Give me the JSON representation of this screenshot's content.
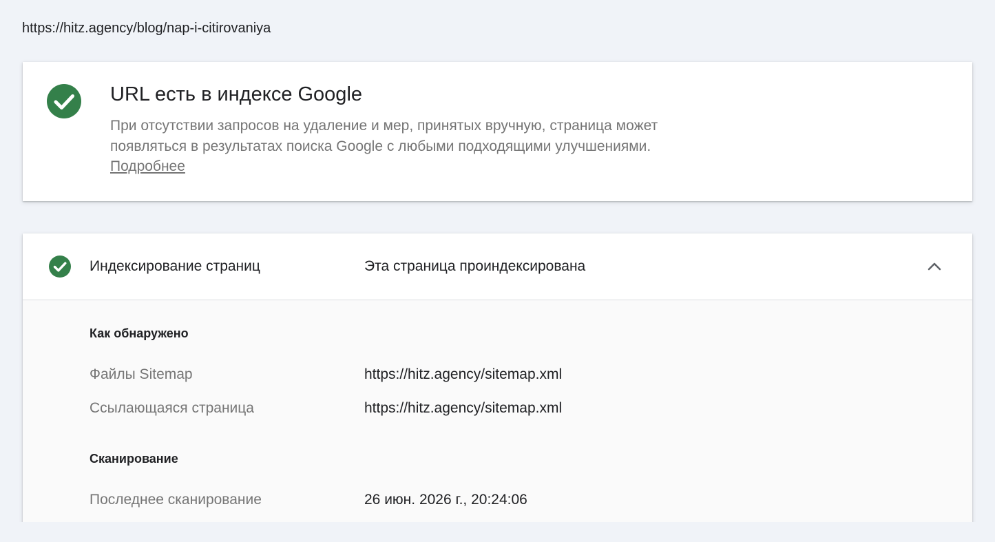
{
  "page_url": "https://hitz.agency/blog/nap-i-citirovaniya",
  "summary": {
    "title": "URL есть в индексе Google",
    "description_line1": "При отсутствии запросов на удаление и мер, принятых вручную, страница может",
    "description_line2": "появляться в результатах поиска Google с любыми подходящими улучшениями.",
    "learn_more": "Подробнее"
  },
  "indexing": {
    "title": "Индексирование страниц",
    "status": "Эта страница проиндексирована",
    "discovery": {
      "heading": "Как обнаружено",
      "rows": [
        {
          "label": "Файлы Sitemap",
          "value": "https://hitz.agency/sitemap.xml"
        },
        {
          "label": "Ссылающаяся страница",
          "value": "https://hitz.agency/sitemap.xml"
        }
      ]
    },
    "crawl": {
      "heading": "Сканирование",
      "rows": [
        {
          "label": "Последнее сканирование",
          "value": "26 июн. 2026 г., 20:24:06"
        }
      ]
    }
  },
  "colors": {
    "success_green": "#34804a",
    "background": "#f0f3f8"
  },
  "icons": {
    "summary_status": "check-circle-icon",
    "indexing_status": "check-circle-icon",
    "collapse": "chevron-up-icon"
  }
}
